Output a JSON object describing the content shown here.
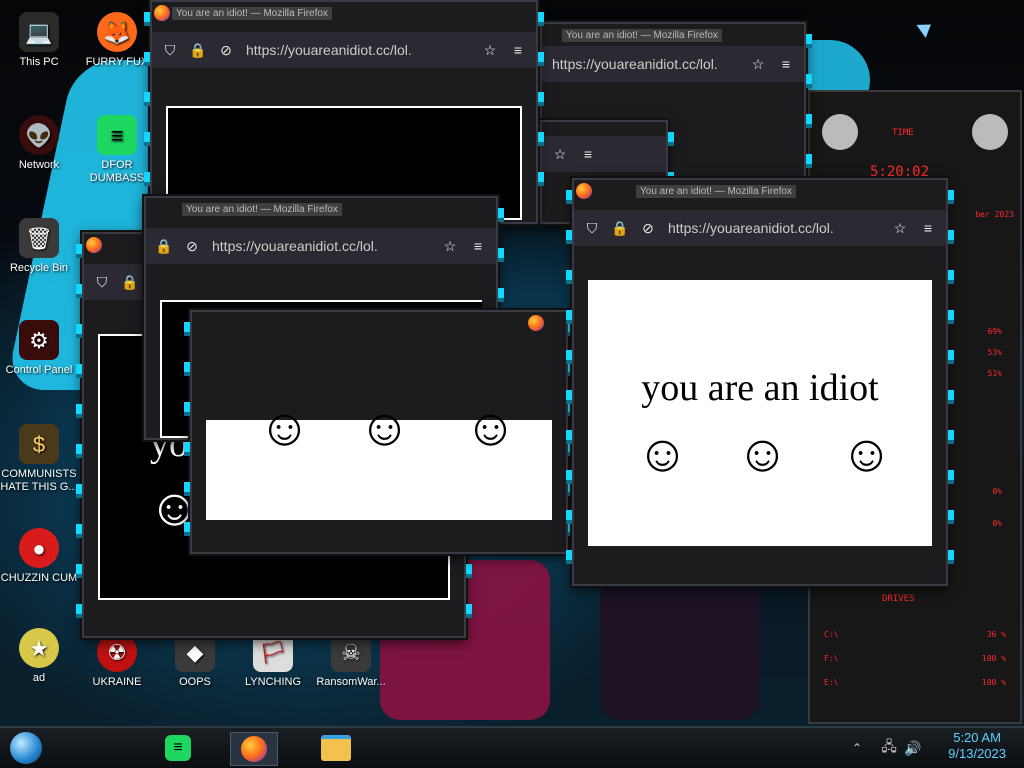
{
  "desktop": {
    "icons": [
      {
        "name": "this-pc",
        "label": "This PC",
        "glyph": "💻",
        "bg": "#2a2a2a"
      },
      {
        "name": "furry-fux",
        "label": "FURRY FUX",
        "glyph": "🦊",
        "bg": "#ff6a1a"
      },
      {
        "name": "network",
        "label": "Network",
        "glyph": "👽",
        "bg": "#3a0b0b"
      },
      {
        "name": "dfor-dumbass",
        "label": "DFOR DUMBASS",
        "glyph": "≡",
        "bg": "#1ed760"
      },
      {
        "name": "recycle-bin",
        "label": "Recycle Bin",
        "glyph": "🗑",
        "bg": "#3a3a3a"
      },
      {
        "name": "control-panel",
        "label": "Control Panel",
        "glyph": "⚙",
        "bg": "#3a0b0b"
      },
      {
        "name": "communists",
        "label": "COMMUNISTS HATE THIS G...",
        "glyph": "$",
        "bg": "#4a3a1a"
      },
      {
        "name": "chuzzin-cum",
        "label": "CHUZZIN CUM",
        "glyph": "●",
        "bg": "#d91b1b"
      },
      {
        "name": "ukraine",
        "label": "UKRAINE",
        "glyph": "☢",
        "bg": "#c01111"
      },
      {
        "name": "oops",
        "label": "OOPS",
        "glyph": "◆",
        "bg": "#3a3a3a"
      },
      {
        "name": "lynching",
        "label": "LYNCHING",
        "glyph": "🏳",
        "bg": "#ddd"
      },
      {
        "name": "ransomware",
        "label": "RansomWar...",
        "glyph": "☠",
        "bg": "#3a3a3a"
      },
      {
        "name": "star",
        "label": "ad",
        "glyph": "★",
        "bg": "#d7c84a"
      }
    ]
  },
  "windows": {
    "title": "You are an idiot! — Mozilla Firefox",
    "url": "https://youareanidiot.cc/lol.",
    "message": "you are an idiot",
    "smiley": "☺"
  },
  "gadget": {
    "time_label": "TIME",
    "time": "5:20:02",
    "date_frag": "ber 2023",
    "stats": [
      "69%",
      "53%",
      "51%",
      "0%",
      "0%"
    ],
    "drives_label": "DRIVES",
    "drives": [
      {
        "letter": "C:\\",
        "pct": "36 %"
      },
      {
        "letter": "F:\\",
        "pct": "100 %"
      },
      {
        "letter": "E:\\",
        "pct": "100 %"
      }
    ]
  },
  "taskbar": {
    "time": "5:20 AM",
    "date": "9/13/2023"
  }
}
